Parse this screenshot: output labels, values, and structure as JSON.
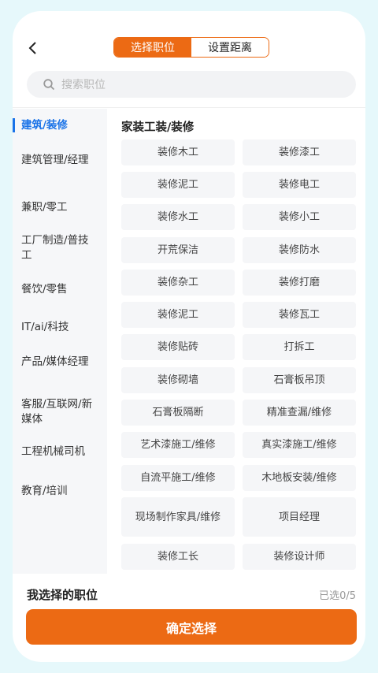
{
  "header": {
    "back_icon": "chevron-left-icon",
    "tabs": [
      {
        "label": "选择职位",
        "active": true
      },
      {
        "label": "设置距离",
        "active": false
      }
    ]
  },
  "search": {
    "placeholder": "搜索职位",
    "icon": "search-icon"
  },
  "sidebar": {
    "items": [
      {
        "label": "建筑/装修",
        "active": true
      },
      {
        "label": "建筑管理/经理",
        "active": false
      },
      {
        "label": "兼职/零工",
        "active": false
      },
      {
        "label": "工厂制造/普技工",
        "active": false
      },
      {
        "label": "餐饮/零售",
        "active": false
      },
      {
        "label": "IT/ai/科技",
        "active": false
      },
      {
        "label": "产品/媒体经理",
        "active": false
      },
      {
        "label": "客服/互联网/新媒体",
        "active": false
      },
      {
        "label": "工程机械司机",
        "active": false
      },
      {
        "label": "教育/培训",
        "active": false
      }
    ]
  },
  "content": {
    "section_title": "家装工装/装修",
    "jobs": [
      "装修木工",
      "装修漆工",
      "装修泥工",
      "装修电工",
      "装修水工",
      "装修小工",
      "开荒保洁",
      "装修防水",
      "装修杂工",
      "装修打磨",
      "装修泥工",
      "装修瓦工",
      "装修贴砖",
      "打拆工",
      "装修砌墙",
      "石膏板吊顶",
      "石膏板隔断",
      "精准查漏/维修",
      "艺术漆施工/维修",
      "真实漆施工/维修",
      "自流平施工/维修",
      "木地板安装/维修",
      "现场制作家具/维修",
      "项目经理",
      "装修工长",
      "装修设计师"
    ]
  },
  "footer": {
    "selected_label": "我选择的职位",
    "selected_count": "已选0/5",
    "confirm_label": "确定选择"
  },
  "colors": {
    "accent": "#ec6a14",
    "active_blue": "#1a73e8",
    "chip_bg": "#f5f6f8"
  }
}
